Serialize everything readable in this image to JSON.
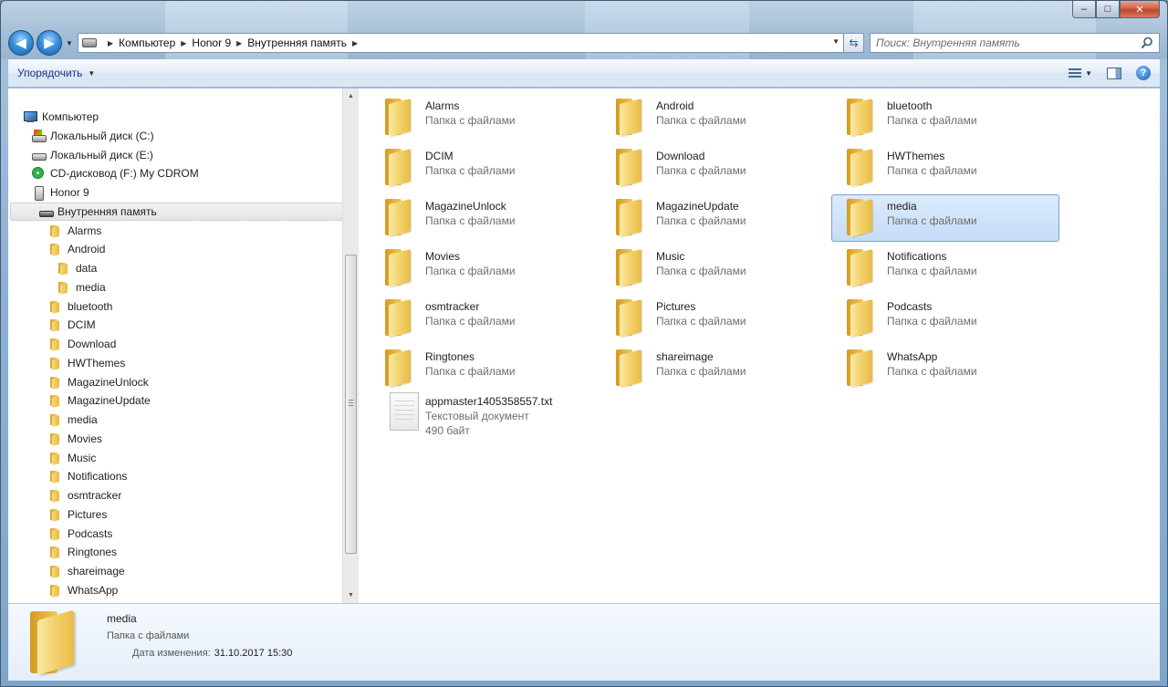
{
  "window": {
    "caption": {
      "minimize": "–",
      "maximize": "□",
      "close": "✕"
    }
  },
  "nav": {
    "back": "◀",
    "forward": "▶",
    "breadcrumbs": [
      "Компьютер",
      "Honor 9",
      "Внутренняя память"
    ],
    "search_placeholder": "Поиск: Внутренняя память"
  },
  "toolbar": {
    "organize_label": "Упорядочить",
    "help": "?"
  },
  "tree": [
    {
      "label": "Компьютер",
      "icon": "computer",
      "indent": 0
    },
    {
      "label": "Локальный диск (C:)",
      "icon": "sysdrive",
      "indent": 1
    },
    {
      "label": "Локальный диск (E:)",
      "icon": "drive",
      "indent": 1
    },
    {
      "label": "CD-дисковод (F:) My CDROM",
      "icon": "cdrom",
      "indent": 1
    },
    {
      "label": "Honor 9",
      "icon": "phone",
      "indent": 1
    },
    {
      "label": "Внутренняя память",
      "icon": "flashdrive",
      "indent": 2,
      "selected": true
    },
    {
      "label": "Alarms",
      "icon": "folder",
      "indent": 3
    },
    {
      "label": "Android",
      "icon": "folder",
      "indent": 3
    },
    {
      "label": "data",
      "icon": "folder",
      "indent": 4
    },
    {
      "label": "media",
      "icon": "folder",
      "indent": 4
    },
    {
      "label": "bluetooth",
      "icon": "folder",
      "indent": 3
    },
    {
      "label": "DCIM",
      "icon": "folder",
      "indent": 3
    },
    {
      "label": "Download",
      "icon": "folder",
      "indent": 3
    },
    {
      "label": "HWThemes",
      "icon": "folder",
      "indent": 3
    },
    {
      "label": "MagazineUnlock",
      "icon": "folder",
      "indent": 3
    },
    {
      "label": "MagazineUpdate",
      "icon": "folder",
      "indent": 3
    },
    {
      "label": "media",
      "icon": "folder",
      "indent": 3
    },
    {
      "label": "Movies",
      "icon": "folder",
      "indent": 3
    },
    {
      "label": "Music",
      "icon": "folder",
      "indent": 3
    },
    {
      "label": "Notifications",
      "icon": "folder",
      "indent": 3
    },
    {
      "label": "osmtracker",
      "icon": "folder",
      "indent": 3
    },
    {
      "label": "Pictures",
      "icon": "folder",
      "indent": 3
    },
    {
      "label": "Podcasts",
      "icon": "folder",
      "indent": 3
    },
    {
      "label": "Ringtones",
      "icon": "folder",
      "indent": 3
    },
    {
      "label": "shareimage",
      "icon": "folder",
      "indent": 3
    },
    {
      "label": "WhatsApp",
      "icon": "folder",
      "indent": 3
    }
  ],
  "items": [
    {
      "name": "Alarms",
      "type": "Папка с файлами",
      "kind": "folder"
    },
    {
      "name": "Android",
      "type": "Папка с файлами",
      "kind": "folder"
    },
    {
      "name": "bluetooth",
      "type": "Папка с файлами",
      "kind": "folder"
    },
    {
      "name": "DCIM",
      "type": "Папка с файлами",
      "kind": "folder"
    },
    {
      "name": "Download",
      "type": "Папка с файлами",
      "kind": "folder"
    },
    {
      "name": "HWThemes",
      "type": "Папка с файлами",
      "kind": "folder"
    },
    {
      "name": "MagazineUnlock",
      "type": "Папка с файлами",
      "kind": "folder"
    },
    {
      "name": "MagazineUpdate",
      "type": "Папка с файлами",
      "kind": "folder"
    },
    {
      "name": "media",
      "type": "Папка с файлами",
      "kind": "folder",
      "selected": true
    },
    {
      "name": "Movies",
      "type": "Папка с файлами",
      "kind": "folder"
    },
    {
      "name": "Music",
      "type": "Папка с файлами",
      "kind": "folder"
    },
    {
      "name": "Notifications",
      "type": "Папка с файлами",
      "kind": "folder"
    },
    {
      "name": "osmtracker",
      "type": "Папка с файлами",
      "kind": "folder"
    },
    {
      "name": "Pictures",
      "type": "Папка с файлами",
      "kind": "folder"
    },
    {
      "name": "Podcasts",
      "type": "Папка с файлами",
      "kind": "folder"
    },
    {
      "name": "Ringtones",
      "type": "Папка с файлами",
      "kind": "folder"
    },
    {
      "name": "shareimage",
      "type": "Папка с файлами",
      "kind": "folder"
    },
    {
      "name": "WhatsApp",
      "type": "Папка с файлами",
      "kind": "folder"
    },
    {
      "name": "appmaster1405358557.txt",
      "type": "Текстовый документ",
      "size": "490 байт",
      "kind": "text"
    }
  ],
  "details": {
    "name": "media",
    "type": "Папка с файлами",
    "modified_label": "Дата изменения:",
    "modified_value": "31.10.2017 15:30"
  },
  "colors": {
    "selection": "#c5dcf7",
    "selection_border": "#7da2ce",
    "link": "#1e3287",
    "secondary_text": "#6d6d6d"
  }
}
